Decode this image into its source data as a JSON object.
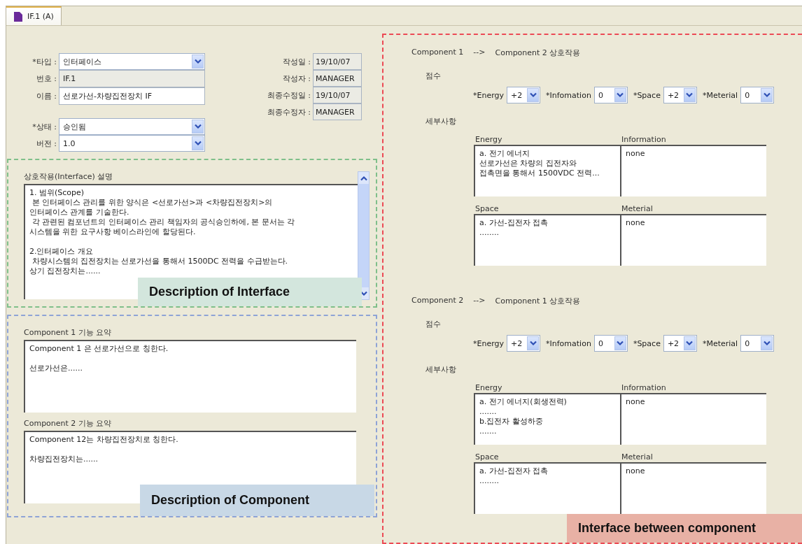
{
  "tab": {
    "label": "IF.1 (A)",
    "selected": true
  },
  "form": {
    "left_groups": [
      [
        {
          "label": "*타입 :",
          "value": "인터페이스",
          "kind": "dropdown"
        },
        {
          "label": "번호 :",
          "value": "IF.1",
          "kind": "readonly"
        },
        {
          "label": "이름 :",
          "value": "선로가선-차량집전장치 IF",
          "kind": "text"
        }
      ],
      [
        {
          "label": "*상태 :",
          "value": "승인됨",
          "kind": "dropdown"
        },
        {
          "label": "버전 :",
          "value": "1.0",
          "kind": "dropdown"
        }
      ]
    ],
    "right": [
      {
        "label": "작성일 :",
        "value": "19/10/07"
      },
      {
        "label": "작성자 :",
        "value": "MANAGER"
      },
      {
        "label": "최종수정일 :",
        "value": "19/10/07"
      },
      {
        "label": "최종수정자 :",
        "value": "MANAGER"
      }
    ]
  },
  "interface_description": {
    "label": "상호작용(Interface) 설명",
    "text": "1. 범위(Scope)\n 본 인터페이스 관리를 위한 양식은 <선로가선>과 <차량집전장치>의\n인터페이스 관계를 기술한다.\n 각 관련된 컴포넌트의 인터페이스 관리 책임자의 공식승인하에, 본 문서는 각\n시스템을 위한 요구사항 베이스라인에 할당된다.\n\n2.인터페이스 개요\n 차량시스템의 집전장치는 선로가선을 통해서 1500DC 전력을 수급받는다.\n상기 집전장치는......",
    "callout": "Description of Interface"
  },
  "component_descriptions": {
    "items": [
      {
        "label": "Component 1 기능 요약",
        "text": "Component 1 은 선로가선으로 칭한다.\n\n선로가선은......"
      },
      {
        "label": "Component 2 기능 요약",
        "text": "Component 12는 차량집전장치로 칭한다.\n\n차량집전장치는......"
      }
    ],
    "callout": "Description of Component"
  },
  "interactions": {
    "items": [
      {
        "heading": [
          "Component 1",
          "-->",
          "Component 2 상호작용"
        ],
        "score_label": "점수",
        "scores": [
          {
            "label": "*Energy",
            "value": "+2"
          },
          {
            "label": "*Infomation",
            "value": "0"
          },
          {
            "label": "*Space",
            "value": "+2"
          },
          {
            "label": "*Meterial",
            "value": "0"
          }
        ],
        "detail_label": "세부사항",
        "details": [
          {
            "label": "Energy",
            "text": "a. 전기 에너지\n선로가선은 차량의 집전자와\n접촉면을 통해서 1500VDC 전력..."
          },
          {
            "label": "Information",
            "text": "none"
          },
          {
            "label": "Space",
            "text": "a. 가선-집전자 접촉\n........"
          },
          {
            "label": "Meterial",
            "text": "none"
          }
        ]
      },
      {
        "heading": [
          "Component 2",
          "-->",
          "Component 1 상호작용"
        ],
        "score_label": "점수",
        "scores": [
          {
            "label": "*Energy",
            "value": "+2"
          },
          {
            "label": "*Infomation",
            "value": "0"
          },
          {
            "label": "*Space",
            "value": "+2"
          },
          {
            "label": "*Meterial",
            "value": "0"
          }
        ],
        "detail_label": "세부사항",
        "details": [
          {
            "label": "Energy",
            "text": "a. 전기 에너지(회생전력)\n.......\nb.집전자 활성하중\n......."
          },
          {
            "label": "Information",
            "text": "none"
          },
          {
            "label": "Space",
            "text": "a. 가선-집전자 접촉\n........"
          },
          {
            "label": "Meterial",
            "text": "none"
          }
        ]
      }
    ],
    "callout": "Interface between component"
  }
}
